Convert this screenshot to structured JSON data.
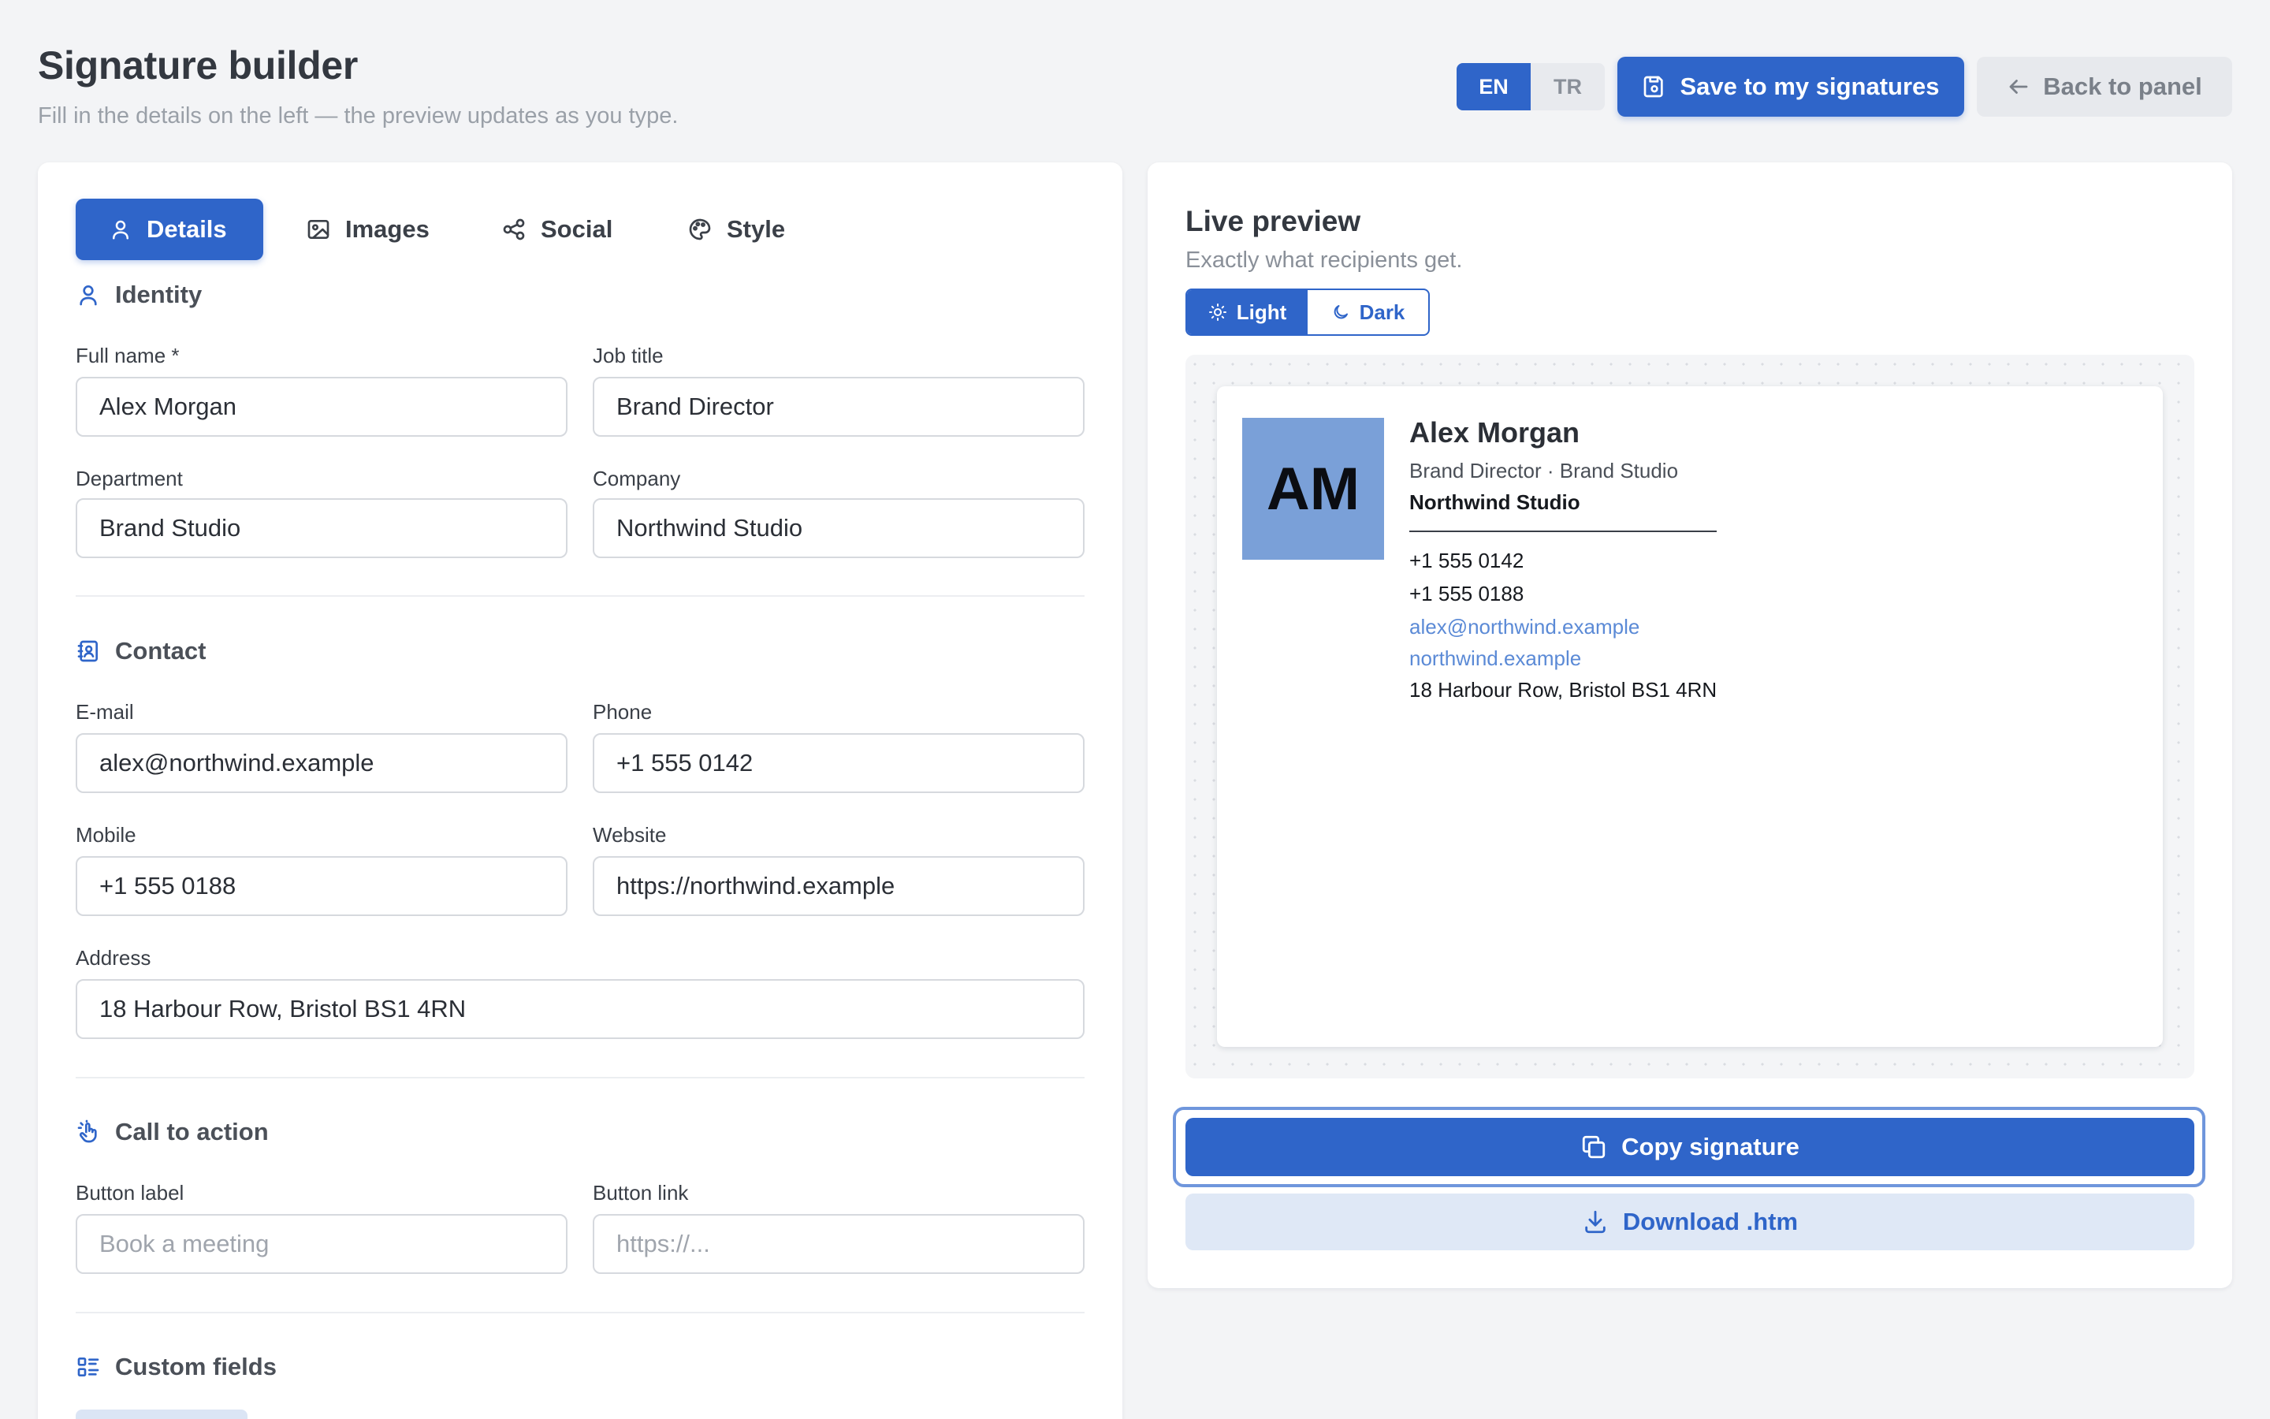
{
  "header": {
    "title": "Signature builder",
    "subtitle": "Fill in the details on the left — the preview updates as you type.",
    "lang_en": "EN",
    "lang_tr": "TR",
    "active_lang": "EN",
    "save_label": "Save to my signatures",
    "back_label": "Back to panel"
  },
  "tabs": {
    "details": "Details",
    "images": "Images",
    "social": "Social",
    "style": "Style",
    "active": "Details"
  },
  "identity": {
    "heading": "Identity",
    "full_name_label": "Full name *",
    "full_name": "Alex Morgan",
    "job_title_label": "Job title",
    "job_title": "Brand Director",
    "department_label": "Department",
    "department": "Brand Studio",
    "company_label": "Company",
    "company": "Northwind Studio"
  },
  "contact": {
    "heading": "Contact",
    "email_label": "E-mail",
    "email": "alex@northwind.example",
    "phone_label": "Phone",
    "phone": "+1 555 0142",
    "mobile_label": "Mobile",
    "mobile": "+1 555 0188",
    "website_label": "Website",
    "website": "https://northwind.example",
    "address_label": "Address",
    "address": "18 Harbour Row, Bristol BS1 4RN"
  },
  "cta": {
    "heading": "Call to action",
    "button_label_label": "Button label",
    "button_label_placeholder": "Book a meeting",
    "button_link_label": "Button link",
    "button_link_placeholder": "https://..."
  },
  "custom_fields": {
    "heading": "Custom fields"
  },
  "preview": {
    "title": "Live preview",
    "subtitle": "Exactly what recipients get.",
    "theme_light": "Light",
    "theme_dark": "Dark",
    "active_theme": "Light",
    "signature": {
      "initials": "AM",
      "name": "Alex Morgan",
      "role_line": "Brand Director · Brand Studio",
      "company": "Northwind Studio",
      "phone": "+1 555 0142",
      "mobile": "+1 555 0188",
      "email": "alex@northwind.example",
      "website": "northwind.example",
      "address": "18 Harbour Row, Bristol BS1 4RN"
    },
    "copy_label": "Copy signature",
    "download_label": "Download .htm"
  },
  "colors": {
    "accent": "#2f65c9",
    "avatar_bg": "#7aa0d8",
    "link": "#5b8ad6",
    "page_bg": "#f3f4f6"
  }
}
